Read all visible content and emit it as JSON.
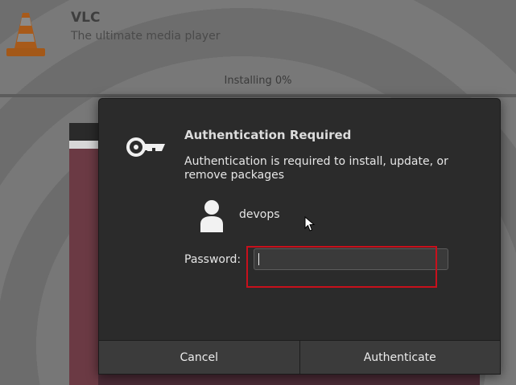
{
  "background_app": {
    "name": "VLC",
    "tagline": "The ultimate media player",
    "install_status": "Installing 0%",
    "install_progress_percent": 0
  },
  "dialog": {
    "title": "Authentication Required",
    "message": "Authentication is required to install, update, or remove packages",
    "username": "devops",
    "password_label": "Password:",
    "password_value": "",
    "cancel_label": "Cancel",
    "authenticate_label": "Authenticate",
    "icons": [
      "key-icon",
      "user-avatar-icon"
    ]
  },
  "colors": {
    "dialog_bg": "#2b2b2b",
    "button_bg": "#3b3b3b",
    "highlight": "#c8101c"
  }
}
